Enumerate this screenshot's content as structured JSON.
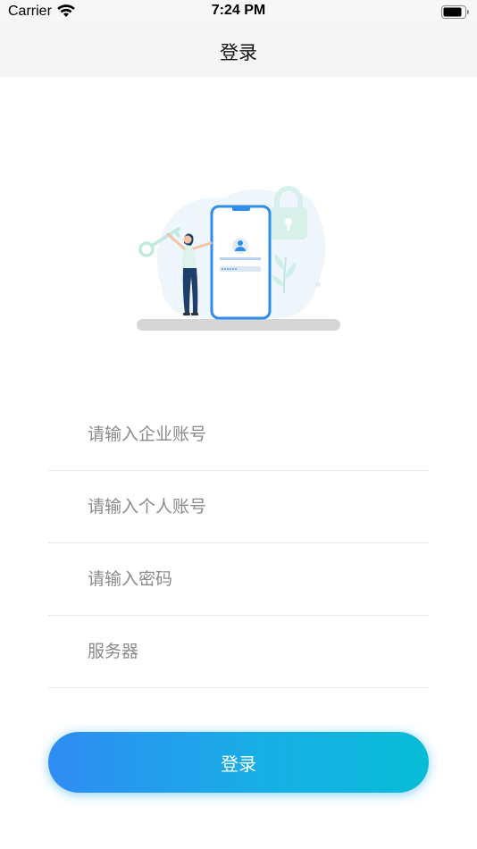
{
  "status_bar": {
    "carrier": "Carrier",
    "time": "7:24 PM"
  },
  "nav": {
    "title": "登录"
  },
  "form": {
    "company_placeholder": "请输入企业账号",
    "personal_placeholder": "请输入个人账号",
    "password_placeholder": "请输入密码",
    "server_placeholder": "服务器"
  },
  "login_button": {
    "label": "登录"
  },
  "colors": {
    "accent_start": "#2f8cf3",
    "accent_end": "#06bcd6"
  }
}
